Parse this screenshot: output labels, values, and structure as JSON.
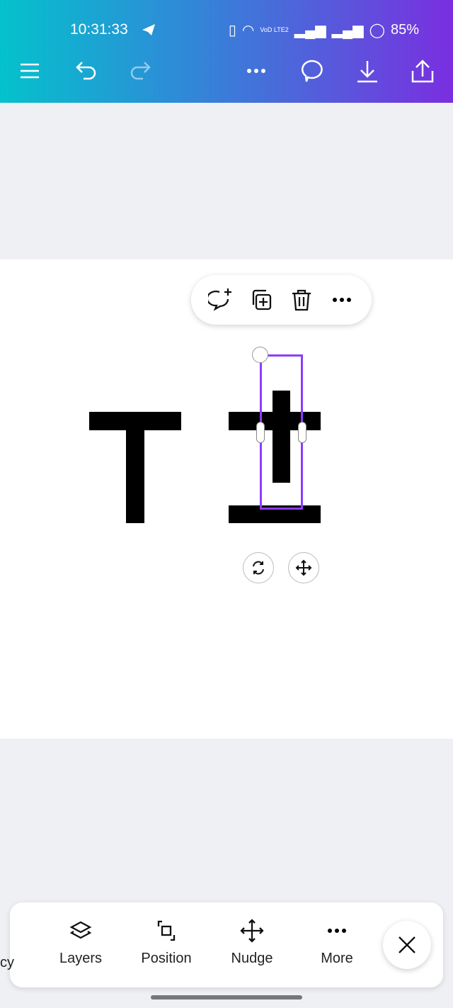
{
  "status_bar": {
    "time": "10:31:33",
    "battery": "85%",
    "network_label": "VoD LTE2"
  },
  "colors": {
    "selection": "#8b3dff",
    "gradient_start": "#04c2cc",
    "gradient_end": "#7a2ee0"
  },
  "bottom_toolbar": {
    "items": [
      {
        "label": "cy"
      },
      {
        "label": "Layers"
      },
      {
        "label": "Position"
      },
      {
        "label": "Nudge"
      },
      {
        "label": "More"
      }
    ]
  }
}
